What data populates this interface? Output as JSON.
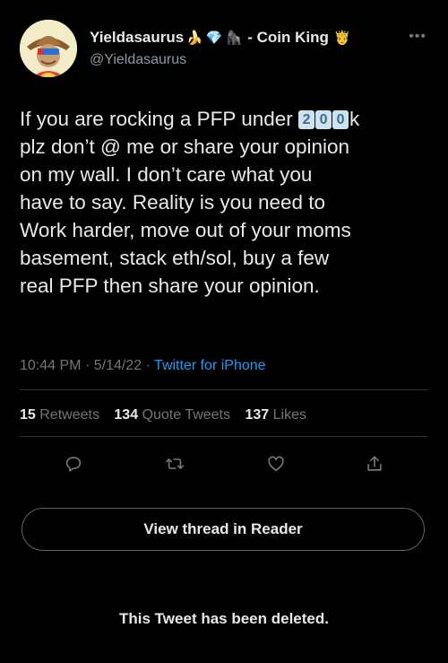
{
  "tweet": {
    "author": {
      "display_name": "Yieldasaurus",
      "name_emojis": [
        "🍌",
        "💎",
        "🦍"
      ],
      "name_suffix": "- Coin King",
      "crown_emoji": "🤴",
      "handle": "@Yieldasaurus"
    },
    "text": {
      "line1_before": "If you are rocking a PFP under",
      "line1_keycaps": [
        "2",
        "0",
        "0"
      ],
      "line1_after": "k",
      "lines": [
        "plz don’t @ me or share your opinion",
        "on my wall.  I don’t care what you",
        "have to say. Reality is you need to",
        "Work harder, move out of your moms",
        "basement, stack eth/sol, buy a few",
        "real PFP then share your opinion."
      ]
    },
    "meta": {
      "time": "10:44 PM",
      "date": "5/14/22",
      "source": "Twitter for iPhone"
    },
    "stats": {
      "retweets_count": "15",
      "retweets_label": "Retweets",
      "quotes_count": "134",
      "quotes_label": "Quote Tweets",
      "likes_count": "137",
      "likes_label": "Likes"
    },
    "actions": {
      "reply_icon": "reply-icon",
      "retweet_icon": "retweet-icon",
      "like_icon": "like-icon",
      "share_icon": "share-icon"
    }
  },
  "reader_button_label": "View thread in Reader",
  "deleted_notice": "This Tweet has been deleted.",
  "colors": {
    "background": "#000000",
    "text": "#e7e9ea",
    "secondary": "#71767b",
    "link": "#1d9bf0",
    "border": "#2f3336"
  }
}
